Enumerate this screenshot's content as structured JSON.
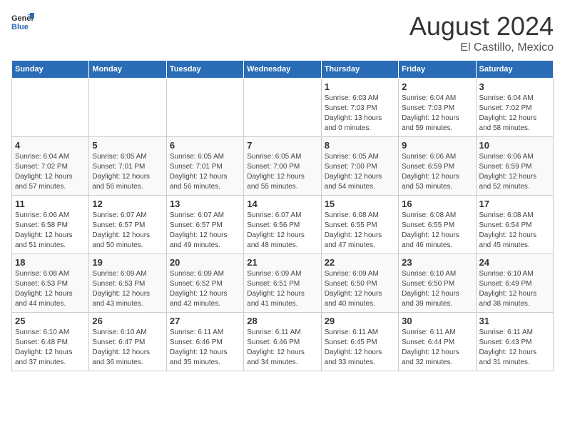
{
  "header": {
    "logo_general": "General",
    "logo_blue": "Blue",
    "title": "August 2024",
    "subtitle": "El Castillo, Mexico"
  },
  "days_of_week": [
    "Sunday",
    "Monday",
    "Tuesday",
    "Wednesday",
    "Thursday",
    "Friday",
    "Saturday"
  ],
  "weeks": [
    [
      {
        "num": "",
        "info": ""
      },
      {
        "num": "",
        "info": ""
      },
      {
        "num": "",
        "info": ""
      },
      {
        "num": "",
        "info": ""
      },
      {
        "num": "1",
        "info": "Sunrise: 6:03 AM\nSunset: 7:03 PM\nDaylight: 13 hours\nand 0 minutes."
      },
      {
        "num": "2",
        "info": "Sunrise: 6:04 AM\nSunset: 7:03 PM\nDaylight: 12 hours\nand 59 minutes."
      },
      {
        "num": "3",
        "info": "Sunrise: 6:04 AM\nSunset: 7:02 PM\nDaylight: 12 hours\nand 58 minutes."
      }
    ],
    [
      {
        "num": "4",
        "info": "Sunrise: 6:04 AM\nSunset: 7:02 PM\nDaylight: 12 hours\nand 57 minutes."
      },
      {
        "num": "5",
        "info": "Sunrise: 6:05 AM\nSunset: 7:01 PM\nDaylight: 12 hours\nand 56 minutes."
      },
      {
        "num": "6",
        "info": "Sunrise: 6:05 AM\nSunset: 7:01 PM\nDaylight: 12 hours\nand 56 minutes."
      },
      {
        "num": "7",
        "info": "Sunrise: 6:05 AM\nSunset: 7:00 PM\nDaylight: 12 hours\nand 55 minutes."
      },
      {
        "num": "8",
        "info": "Sunrise: 6:05 AM\nSunset: 7:00 PM\nDaylight: 12 hours\nand 54 minutes."
      },
      {
        "num": "9",
        "info": "Sunrise: 6:06 AM\nSunset: 6:59 PM\nDaylight: 12 hours\nand 53 minutes."
      },
      {
        "num": "10",
        "info": "Sunrise: 6:06 AM\nSunset: 6:59 PM\nDaylight: 12 hours\nand 52 minutes."
      }
    ],
    [
      {
        "num": "11",
        "info": "Sunrise: 6:06 AM\nSunset: 6:58 PM\nDaylight: 12 hours\nand 51 minutes."
      },
      {
        "num": "12",
        "info": "Sunrise: 6:07 AM\nSunset: 6:57 PM\nDaylight: 12 hours\nand 50 minutes."
      },
      {
        "num": "13",
        "info": "Sunrise: 6:07 AM\nSunset: 6:57 PM\nDaylight: 12 hours\nand 49 minutes."
      },
      {
        "num": "14",
        "info": "Sunrise: 6:07 AM\nSunset: 6:56 PM\nDaylight: 12 hours\nand 48 minutes."
      },
      {
        "num": "15",
        "info": "Sunrise: 6:08 AM\nSunset: 6:55 PM\nDaylight: 12 hours\nand 47 minutes."
      },
      {
        "num": "16",
        "info": "Sunrise: 6:08 AM\nSunset: 6:55 PM\nDaylight: 12 hours\nand 46 minutes."
      },
      {
        "num": "17",
        "info": "Sunrise: 6:08 AM\nSunset: 6:54 PM\nDaylight: 12 hours\nand 45 minutes."
      }
    ],
    [
      {
        "num": "18",
        "info": "Sunrise: 6:08 AM\nSunset: 6:53 PM\nDaylight: 12 hours\nand 44 minutes."
      },
      {
        "num": "19",
        "info": "Sunrise: 6:09 AM\nSunset: 6:53 PM\nDaylight: 12 hours\nand 43 minutes."
      },
      {
        "num": "20",
        "info": "Sunrise: 6:09 AM\nSunset: 6:52 PM\nDaylight: 12 hours\nand 42 minutes."
      },
      {
        "num": "21",
        "info": "Sunrise: 6:09 AM\nSunset: 6:51 PM\nDaylight: 12 hours\nand 41 minutes."
      },
      {
        "num": "22",
        "info": "Sunrise: 6:09 AM\nSunset: 6:50 PM\nDaylight: 12 hours\nand 40 minutes."
      },
      {
        "num": "23",
        "info": "Sunrise: 6:10 AM\nSunset: 6:50 PM\nDaylight: 12 hours\nand 39 minutes."
      },
      {
        "num": "24",
        "info": "Sunrise: 6:10 AM\nSunset: 6:49 PM\nDaylight: 12 hours\nand 38 minutes."
      }
    ],
    [
      {
        "num": "25",
        "info": "Sunrise: 6:10 AM\nSunset: 6:48 PM\nDaylight: 12 hours\nand 37 minutes."
      },
      {
        "num": "26",
        "info": "Sunrise: 6:10 AM\nSunset: 6:47 PM\nDaylight: 12 hours\nand 36 minutes."
      },
      {
        "num": "27",
        "info": "Sunrise: 6:11 AM\nSunset: 6:46 PM\nDaylight: 12 hours\nand 35 minutes."
      },
      {
        "num": "28",
        "info": "Sunrise: 6:11 AM\nSunset: 6:46 PM\nDaylight: 12 hours\nand 34 minutes."
      },
      {
        "num": "29",
        "info": "Sunrise: 6:11 AM\nSunset: 6:45 PM\nDaylight: 12 hours\nand 33 minutes."
      },
      {
        "num": "30",
        "info": "Sunrise: 6:11 AM\nSunset: 6:44 PM\nDaylight: 12 hours\nand 32 minutes."
      },
      {
        "num": "31",
        "info": "Sunrise: 6:11 AM\nSunset: 6:43 PM\nDaylight: 12 hours\nand 31 minutes."
      }
    ]
  ]
}
